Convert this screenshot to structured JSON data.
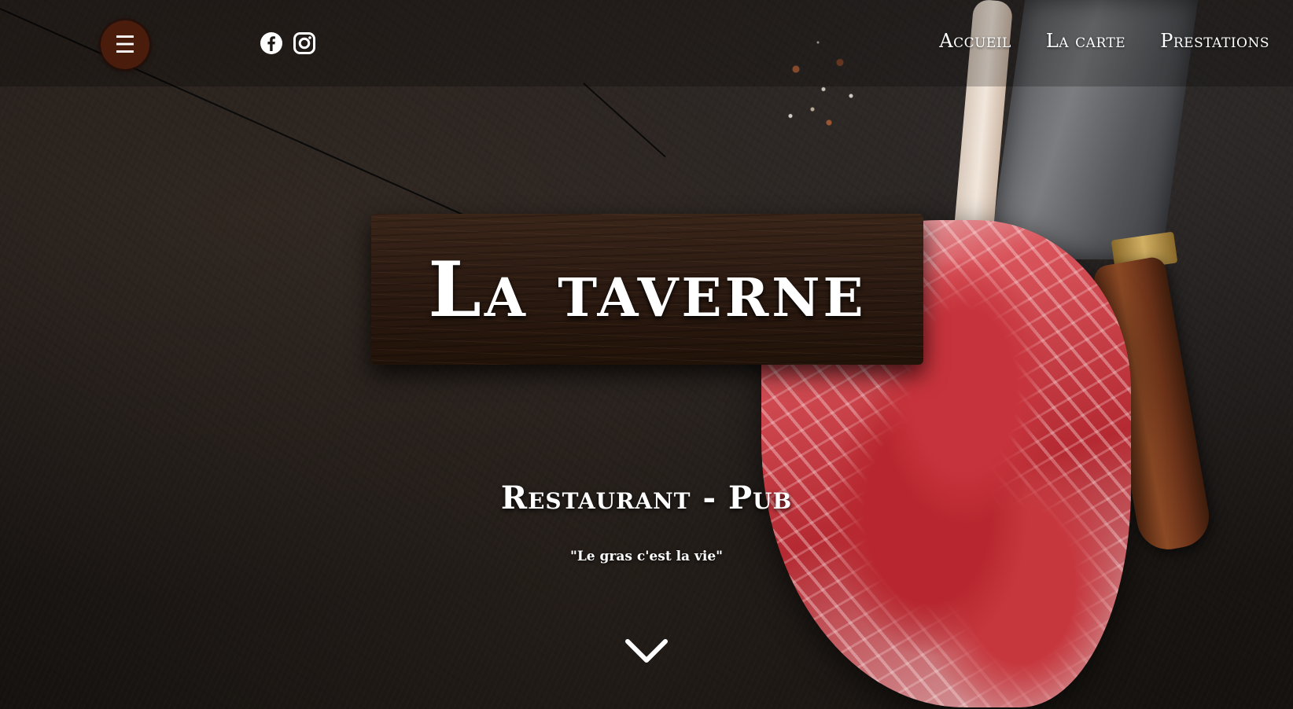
{
  "nav": {
    "menu_icon": "☰",
    "items": [
      {
        "label": "Accueil"
      },
      {
        "label": "La carte"
      },
      {
        "label": "Prestations"
      }
    ]
  },
  "social": {
    "icons": [
      "facebook-icon",
      "instagram-icon"
    ]
  },
  "hero": {
    "title": "La taverne",
    "subtitle": "Restaurant - Pub",
    "tagline": "\"Le gras c'est la vie\""
  },
  "colors": {
    "menu_button": "#4a1c0c",
    "text": "#ffffff",
    "board": "#2b1a11"
  },
  "scroll_icon": "chevron-down-icon"
}
